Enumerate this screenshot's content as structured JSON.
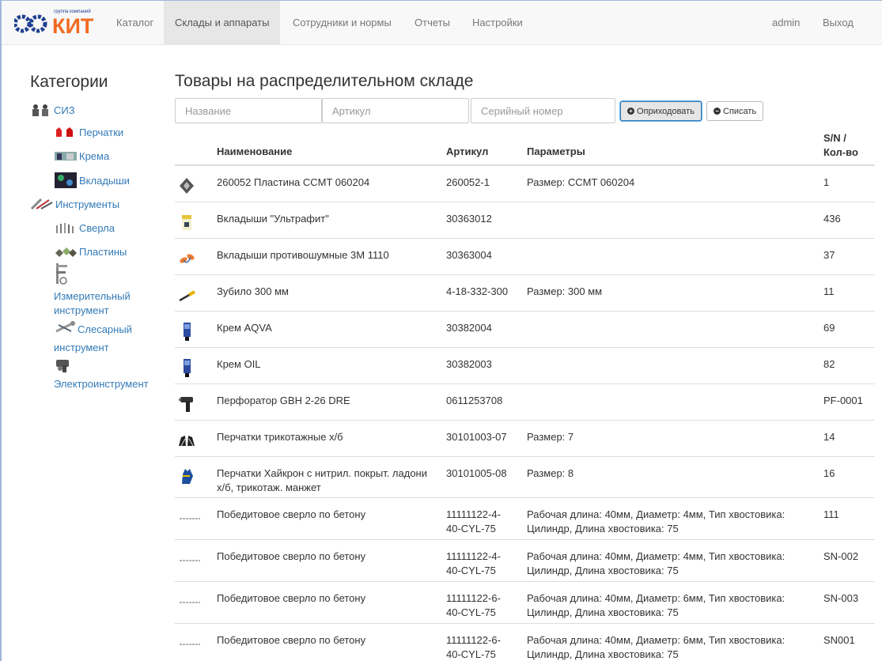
{
  "brand": {
    "small_text": "группа компаний",
    "logo_text": "РСКИТ"
  },
  "nav": {
    "items": [
      {
        "label": "Каталог",
        "active": false
      },
      {
        "label": "Склады и аппараты",
        "active": true
      },
      {
        "label": "Сотрудники и нормы",
        "active": false
      },
      {
        "label": "Отчеты",
        "active": false
      },
      {
        "label": "Настройки",
        "active": false
      }
    ],
    "user": "admin",
    "logout": "Выход"
  },
  "sidebar": {
    "title": "Категории",
    "groups": [
      {
        "label": "СИЗ",
        "icon": "workers-icon",
        "children": [
          {
            "label": "Перчатки",
            "icon": "gloves-icon"
          },
          {
            "label": "Крема",
            "icon": "cream-icon"
          },
          {
            "label": "Вкладыши",
            "icon": "earplugs-icon"
          }
        ]
      },
      {
        "label": "Инструменты",
        "icon": "tools-icon",
        "children": [
          {
            "label": "Сверла",
            "icon": "drills-icon"
          },
          {
            "label": "Пластины",
            "icon": "plates-icon"
          },
          {
            "label": "Измерительный инструмент",
            "line1": "Измерительный",
            "line2": "инструмент",
            "icon": "caliper-icon"
          },
          {
            "label": "Слесарный инструмент",
            "line1": "Слесарный",
            "line2": "инструмент",
            "icon": "wrench-icon"
          },
          {
            "label": "Электроинструмент",
            "icon": "power-tool-icon"
          }
        ]
      }
    ]
  },
  "main": {
    "title": "Товары на распределительном складе",
    "filters": {
      "name_placeholder": "Название",
      "article_placeholder": "Артикул",
      "serial_placeholder": "Серийный номер"
    },
    "buttons": {
      "receive": "Оприходовать",
      "write_off": "Списать"
    },
    "columns": {
      "name": "Наименование",
      "article": "Артикул",
      "params": "Параметры",
      "qty_line1": "S/N /",
      "qty_line2": "Кол-во"
    },
    "rows": [
      {
        "icon": "insert-plate-icon",
        "name": "260052 Пластина CCMT 060204",
        "article": "260052-1",
        "params": "Размер: CCMT 060204",
        "qty": "1"
      },
      {
        "icon": "earplugs-pack-icon",
        "name": "Вкладыши \"Ультрафит\"",
        "article": "30363012",
        "params": "",
        "qty": "436"
      },
      {
        "icon": "earplugs-icon",
        "name": "Вкладыши противошумные 3М 1110",
        "article": "30363004",
        "params": "",
        "qty": "37"
      },
      {
        "icon": "chisel-icon",
        "name": "Зубило 300 мм",
        "article": "4-18-332-300",
        "params": "Размер: 300 мм",
        "qty": "11"
      },
      {
        "icon": "cream-tube-icon",
        "name": "Крем AQVA",
        "article": "30382004",
        "params": "",
        "qty": "69"
      },
      {
        "icon": "cream-tube-icon",
        "name": "Крем OIL",
        "article": "30382003",
        "params": "",
        "qty": "82"
      },
      {
        "icon": "rotary-hammer-icon",
        "name": "Перфоратор GBH 2-26 DRE",
        "article": "0611253708",
        "params": "",
        "qty": "PF-0001"
      },
      {
        "icon": "knit-gloves-icon",
        "name": "Перчатки трикотажные х/б",
        "article": "30101003-07",
        "params": "Размер: 7",
        "qty": "14"
      },
      {
        "icon": "coated-gloves-icon",
        "name": "Перчатки Хайкрон с нитрил. покрыт. ладони",
        "name2": "х/б, трикотаж. манжет",
        "article": "30101005-08",
        "params": "Размер: 8",
        "qty": "16"
      },
      {
        "icon": "drill-bit-icon",
        "name": "Победитовое сверло по бетону",
        "article": "11111122-4-",
        "article2": "40-CYL-75",
        "params": "Рабочая длина: 40мм, Диаметр: 4мм, Тип хвостовика:",
        "params2": "Цилиндр, Длина хвостовика: 75",
        "qty": "111"
      },
      {
        "icon": "drill-bit-icon",
        "name": "Победитовое сверло по бетону",
        "article": "11111122-4-",
        "article2": "40-CYL-75",
        "params": "Рабочая длина: 40мм, Диаметр: 4мм, Тип хвостовика:",
        "params2": "Цилиндр, Длина хвостовика: 75",
        "qty": "SN-002"
      },
      {
        "icon": "drill-bit-icon",
        "name": "Победитовое сверло по бетону",
        "article": "11111122-6-",
        "article2": "40-CYL-75",
        "params": "Рабочая длина: 40мм, Диаметр: 6мм, Тип хвостовика:",
        "params2": "Цилиндр, Длина хвостовика: 75",
        "qty": "SN-003"
      },
      {
        "icon": "drill-bit-icon",
        "name": "Победитовое сверло по бетону",
        "article": "11111122-6-",
        "article2": "40-CYL-75",
        "params": "Рабочая длина: 40мм, Диаметр: 6мм, Тип хвостовика:",
        "params2": "Цилиндр, Длина хвостовика: 75",
        "qty": "SN001"
      }
    ]
  },
  "colors": {
    "link": "#337ab7",
    "logo_blue": "#1e3f8f",
    "logo_orange": "#f26a21",
    "nav_bg": "#f8f8f8",
    "nav_active": "#e7e7e7"
  }
}
